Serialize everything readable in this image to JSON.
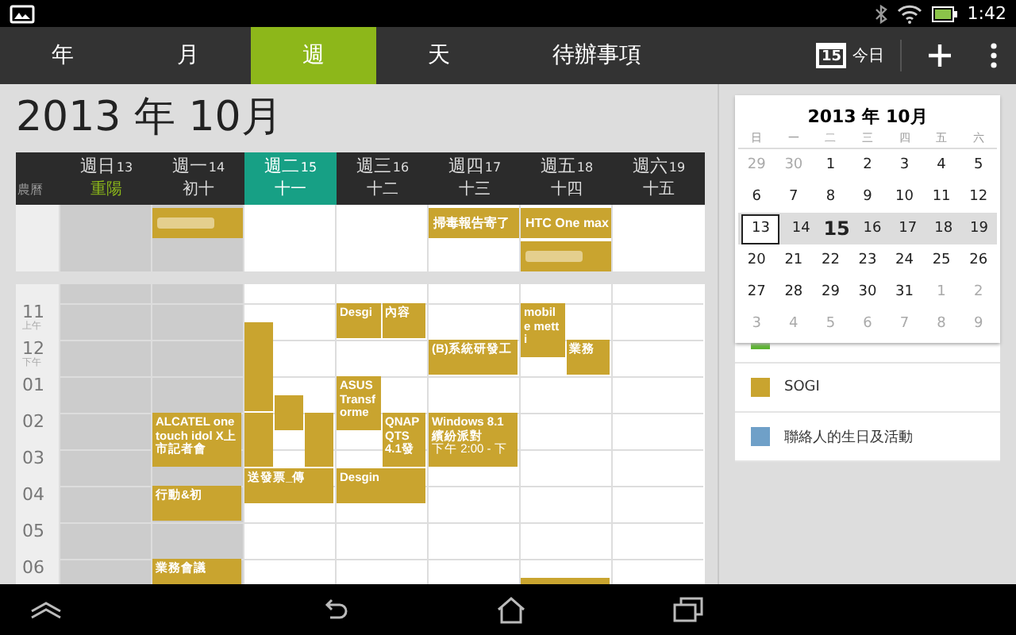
{
  "status_bar": {
    "time": "1:42"
  },
  "tabs": [
    {
      "label": "年",
      "selected": false
    },
    {
      "label": "月",
      "selected": false
    },
    {
      "label": "週",
      "selected": true
    },
    {
      "label": "天",
      "selected": false
    },
    {
      "label": "待辦事項",
      "selected": false
    }
  ],
  "toolbar": {
    "today_date": "15",
    "today_label": "今日"
  },
  "title": "2013 年 10月",
  "week": {
    "lunar_label": "農曆",
    "days": [
      {
        "weekday": "週日",
        "date": "13",
        "lunar": "重陽",
        "holiday": true,
        "past": true,
        "today": false
      },
      {
        "weekday": "週一",
        "date": "14",
        "lunar": "初十",
        "holiday": false,
        "past": true,
        "today": false,
        "all_day": [
          {
            "kind": "redacted"
          }
        ],
        "events": [
          {
            "kind": "titled",
            "title": "ALCATEL onetouch idol X上市記者會"
          },
          {
            "kind": "titled",
            "title": "行動&初"
          },
          {
            "kind": "titled",
            "title": "業務會議"
          }
        ]
      },
      {
        "weekday": "週二",
        "date": "15",
        "lunar": "十一",
        "holiday": false,
        "past": false,
        "today": true,
        "events": [
          {
            "kind": "untitled"
          },
          {
            "kind": "untitled"
          },
          {
            "kind": "untitled"
          },
          {
            "kind": "untitled"
          },
          {
            "kind": "titled",
            "title": "送發票_傳"
          }
        ]
      },
      {
        "weekday": "週三",
        "date": "16",
        "lunar": "十二",
        "holiday": false,
        "past": false,
        "today": false,
        "events": [
          {
            "kind": "titled",
            "title": "Desgi"
          },
          {
            "kind": "titled",
            "title": "內容"
          },
          {
            "kind": "titled",
            "title": "ASUS Transforme"
          },
          {
            "kind": "titled",
            "title": "QNAP QTS 4.1發"
          },
          {
            "kind": "titled",
            "title": "Desgin"
          }
        ]
      },
      {
        "weekday": "週四",
        "date": "17",
        "lunar": "十三",
        "holiday": false,
        "past": false,
        "today": false,
        "all_day": [
          {
            "kind": "titled",
            "title": "掃毒報告寄了"
          }
        ],
        "events": [
          {
            "kind": "titled",
            "title": "(B)系統研發工"
          },
          {
            "kind": "titled",
            "title": "Windows 8.1 繽紛派對",
            "time": "下午 2:00 - 下"
          }
        ]
      },
      {
        "weekday": "週五",
        "date": "18",
        "lunar": "十四",
        "holiday": false,
        "past": false,
        "today": false,
        "all_day": [
          {
            "kind": "titled",
            "title": "HTC One max"
          },
          {
            "kind": "redacted"
          }
        ],
        "events": [
          {
            "kind": "titled",
            "title": "mobile metti"
          },
          {
            "kind": "titled",
            "title": "業務"
          },
          {
            "kind": "untitled"
          }
        ]
      },
      {
        "weekday": "週六",
        "date": "19",
        "lunar": "十五",
        "holiday": false,
        "past": false,
        "today": false
      }
    ]
  },
  "hours": [
    {
      "label": "11",
      "period": "上午"
    },
    {
      "label": "12",
      "period": "下午"
    },
    {
      "label": "01"
    },
    {
      "label": "02"
    },
    {
      "label": "03"
    },
    {
      "label": "04"
    },
    {
      "label": "05"
    },
    {
      "label": "06"
    }
  ],
  "mini_calendar": {
    "title": "2013 年 10月",
    "weekdays": [
      "日",
      "一",
      "二",
      "三",
      "四",
      "五",
      "六"
    ],
    "weeks": [
      {
        "highlighted": false,
        "days": [
          {
            "label": "29",
            "other_month": true,
            "selected": false,
            "today": false
          },
          {
            "label": "30",
            "other_month": true,
            "selected": false,
            "today": false
          },
          {
            "label": "1",
            "other_month": false,
            "selected": false,
            "today": false
          },
          {
            "label": "2",
            "other_month": false,
            "selected": false,
            "today": false
          },
          {
            "label": "3",
            "other_month": false,
            "selected": false,
            "today": false
          },
          {
            "label": "4",
            "other_month": false,
            "selected": false,
            "today": false
          },
          {
            "label": "5",
            "other_month": false,
            "selected": false,
            "today": false
          }
        ]
      },
      {
        "highlighted": false,
        "days": [
          {
            "label": "6",
            "other_month": false,
            "selected": false,
            "today": false
          },
          {
            "label": "7",
            "other_month": false,
            "selected": false,
            "today": false
          },
          {
            "label": "8",
            "other_month": false,
            "selected": false,
            "today": false
          },
          {
            "label": "9",
            "other_month": false,
            "selected": false,
            "today": false
          },
          {
            "label": "10",
            "other_month": false,
            "selected": false,
            "today": false
          },
          {
            "label": "11",
            "other_month": false,
            "selected": false,
            "today": false
          },
          {
            "label": "12",
            "other_month": false,
            "selected": false,
            "today": false
          }
        ]
      },
      {
        "highlighted": true,
        "days": [
          {
            "label": "13",
            "other_month": false,
            "selected": true,
            "today": false
          },
          {
            "label": "14",
            "other_month": false,
            "selected": false,
            "today": false
          },
          {
            "label": "15",
            "other_month": false,
            "selected": false,
            "today": true
          },
          {
            "label": "16",
            "other_month": false,
            "selected": false,
            "today": false
          },
          {
            "label": "17",
            "other_month": false,
            "selected": false,
            "today": false
          },
          {
            "label": "18",
            "other_month": false,
            "selected": false,
            "today": false
          },
          {
            "label": "19",
            "other_month": false,
            "selected": false,
            "today": false
          }
        ]
      },
      {
        "highlighted": false,
        "days": [
          {
            "label": "20",
            "other_month": false,
            "selected": false,
            "today": false
          },
          {
            "label": "21",
            "other_month": false,
            "selected": false,
            "today": false
          },
          {
            "label": "22",
            "other_month": false,
            "selected": false,
            "today": false
          },
          {
            "label": "23",
            "other_month": false,
            "selected": false,
            "today": false
          },
          {
            "label": "24",
            "other_month": false,
            "selected": false,
            "today": false
          },
          {
            "label": "25",
            "other_month": false,
            "selected": false,
            "today": false
          },
          {
            "label": "26",
            "other_month": false,
            "selected": false,
            "today": false
          }
        ]
      },
      {
        "highlighted": false,
        "days": [
          {
            "label": "27",
            "other_month": false,
            "selected": false,
            "today": false
          },
          {
            "label": "28",
            "other_month": false,
            "selected": false,
            "today": false
          },
          {
            "label": "29",
            "other_month": false,
            "selected": false,
            "today": false
          },
          {
            "label": "30",
            "other_month": false,
            "selected": false,
            "today": false
          },
          {
            "label": "31",
            "other_month": false,
            "selected": false,
            "today": false
          },
          {
            "label": "1",
            "other_month": true,
            "selected": false,
            "today": false
          },
          {
            "label": "2",
            "other_month": true,
            "selected": false,
            "today": false
          }
        ]
      },
      {
        "highlighted": false,
        "days": [
          {
            "label": "3",
            "other_month": true,
            "selected": false,
            "today": false
          },
          {
            "label": "4",
            "other_month": true,
            "selected": false,
            "today": false
          },
          {
            "label": "5",
            "other_month": true,
            "selected": false,
            "today": false
          },
          {
            "label": "6",
            "other_month": true,
            "selected": false,
            "today": false
          },
          {
            "label": "7",
            "other_month": true,
            "selected": false,
            "today": false
          },
          {
            "label": "8",
            "other_month": true,
            "selected": false,
            "today": false
          },
          {
            "label": "9",
            "other_month": true,
            "selected": false,
            "today": false
          }
        ]
      }
    ]
  },
  "calendars": [
    {
      "color": "#5cb531"
    },
    {
      "name": "SOGI",
      "color": "#c9a42f"
    },
    {
      "name": "聯絡人的生日及活動",
      "color": "#6fa0c8"
    }
  ]
}
